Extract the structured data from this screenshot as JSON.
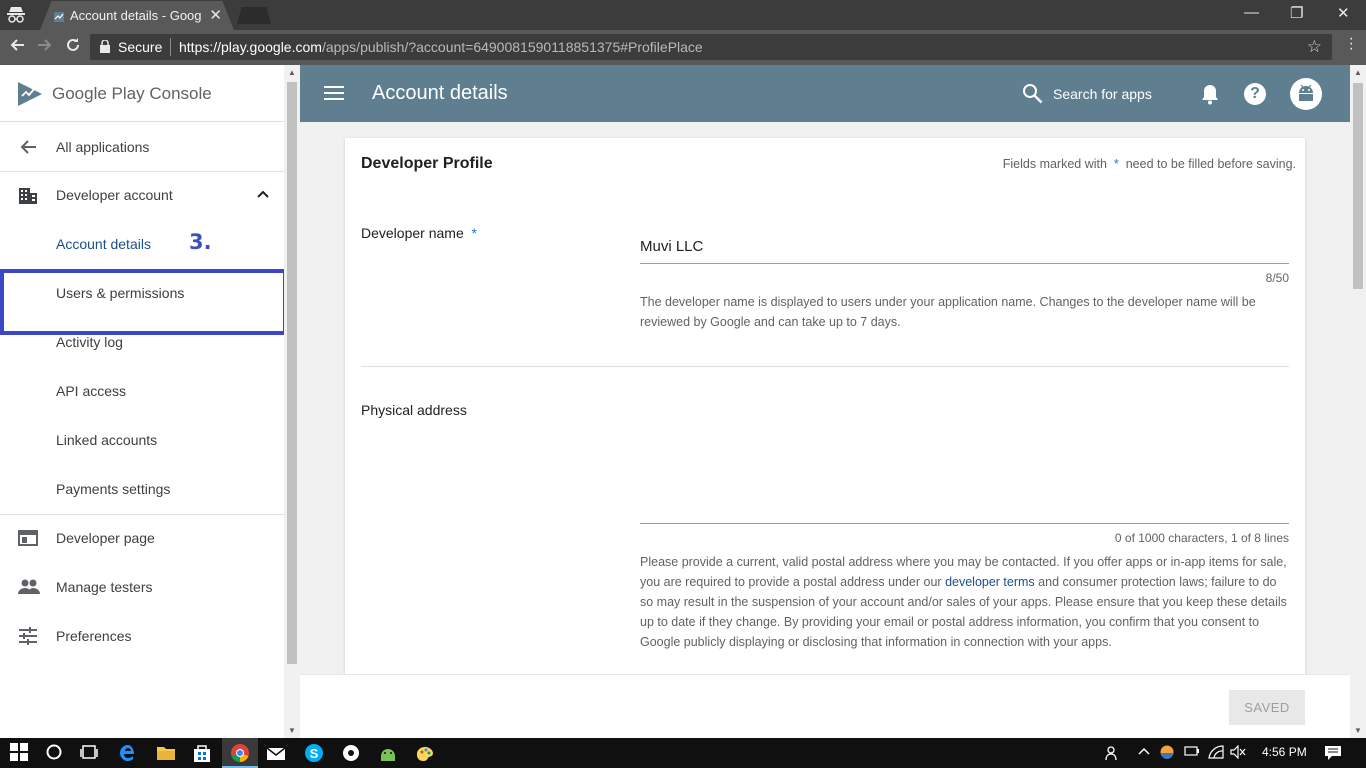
{
  "browser": {
    "tab_title": "Account details - Google",
    "tab_close": "✕",
    "secure_label": "Secure",
    "url_host": "https://play.google.com",
    "url_path": "/apps/publish/?account=6490081590118851375#ProfilePlace",
    "window_controls": {
      "minimize": "—",
      "restore": "❐",
      "close": "✕"
    }
  },
  "sidebar": {
    "brand_google": "Google Play",
    "brand_console": "Console",
    "items": [
      {
        "label": "All applications",
        "icon": "arrow-back-icon"
      },
      {
        "label": "Developer account",
        "icon": "building-icon"
      },
      {
        "label": "Account details",
        "active": true
      },
      {
        "label": "Users & permissions"
      },
      {
        "label": "Activity log"
      },
      {
        "label": "API access"
      },
      {
        "label": "Linked accounts"
      },
      {
        "label": "Payments settings"
      },
      {
        "label": "Developer page",
        "icon": "web-page-icon"
      },
      {
        "label": "Manage testers",
        "icon": "people-icon"
      },
      {
        "label": "Preferences",
        "icon": "sliders-icon"
      }
    ],
    "step_marker": "3."
  },
  "header": {
    "title": "Account details",
    "search_label": "Search for apps",
    "help_symbol": "?"
  },
  "card": {
    "title": "Developer Profile",
    "required_note_before": "Fields marked with",
    "required_symbol": "*",
    "required_note_after": "need to be filled before saving.",
    "developer_name": {
      "label": "Developer name",
      "value": "Muvi LLC",
      "counter": "8/50",
      "help": "The developer name is displayed to users under your application name. Changes to the developer name will be reviewed by Google and can take up to 7 days."
    },
    "physical_address": {
      "label": "Physical address",
      "value": "",
      "counter": "0 of 1000 characters, 1 of 8 lines",
      "help_before_link": "Please provide a current, valid postal address where you may be contacted. If you offer apps or in-app items for sale, you are required to provide a postal address under our ",
      "help_link": "developer terms",
      "help_after_link": " and consumer protection laws; failure to do so may result in the suspension of your account and/or sales of your apps. Please ensure that you keep these details up to date if they change. By providing your email or postal address information, you confirm that you consent to Google publicly displaying or disclosing that information in connection with your apps."
    }
  },
  "footer": {
    "saved_label": "SAVED"
  },
  "taskbar": {
    "time": "4:56 PM"
  },
  "colors": {
    "header_bg": "#5f7f90",
    "highlight": "#3b47c4",
    "active_link": "#1a4f8b",
    "step_marker": "#3f51b5"
  }
}
